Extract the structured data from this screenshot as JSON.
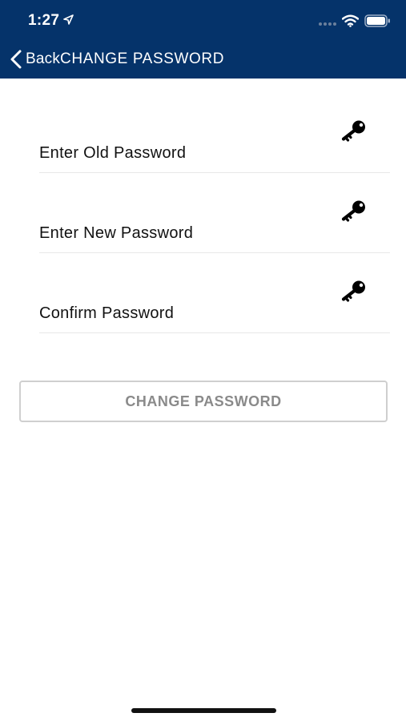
{
  "status_bar": {
    "time": "1:27",
    "icons": [
      "location-arrow-icon",
      "cellular-signal-icon",
      "wifi-icon",
      "battery-icon"
    ]
  },
  "nav": {
    "back_label": "Back",
    "title": "CHANGE PASSWORD",
    "back_icon": "chevron-left-icon"
  },
  "form": {
    "fields": [
      {
        "placeholder": "Enter Old Password",
        "value": "",
        "icon": "key-icon"
      },
      {
        "placeholder": "Enter New Password",
        "value": "",
        "icon": "key-icon"
      },
      {
        "placeholder": "Confirm Password",
        "value": "",
        "icon": "key-icon"
      }
    ],
    "submit_label": "CHANGE PASSWORD"
  },
  "colors": {
    "header_background": "#05336a",
    "header_text": "#ffffff",
    "button_border": "#cfcfcf",
    "button_text": "#8a8a8a",
    "divider": "#e8e8e8"
  }
}
